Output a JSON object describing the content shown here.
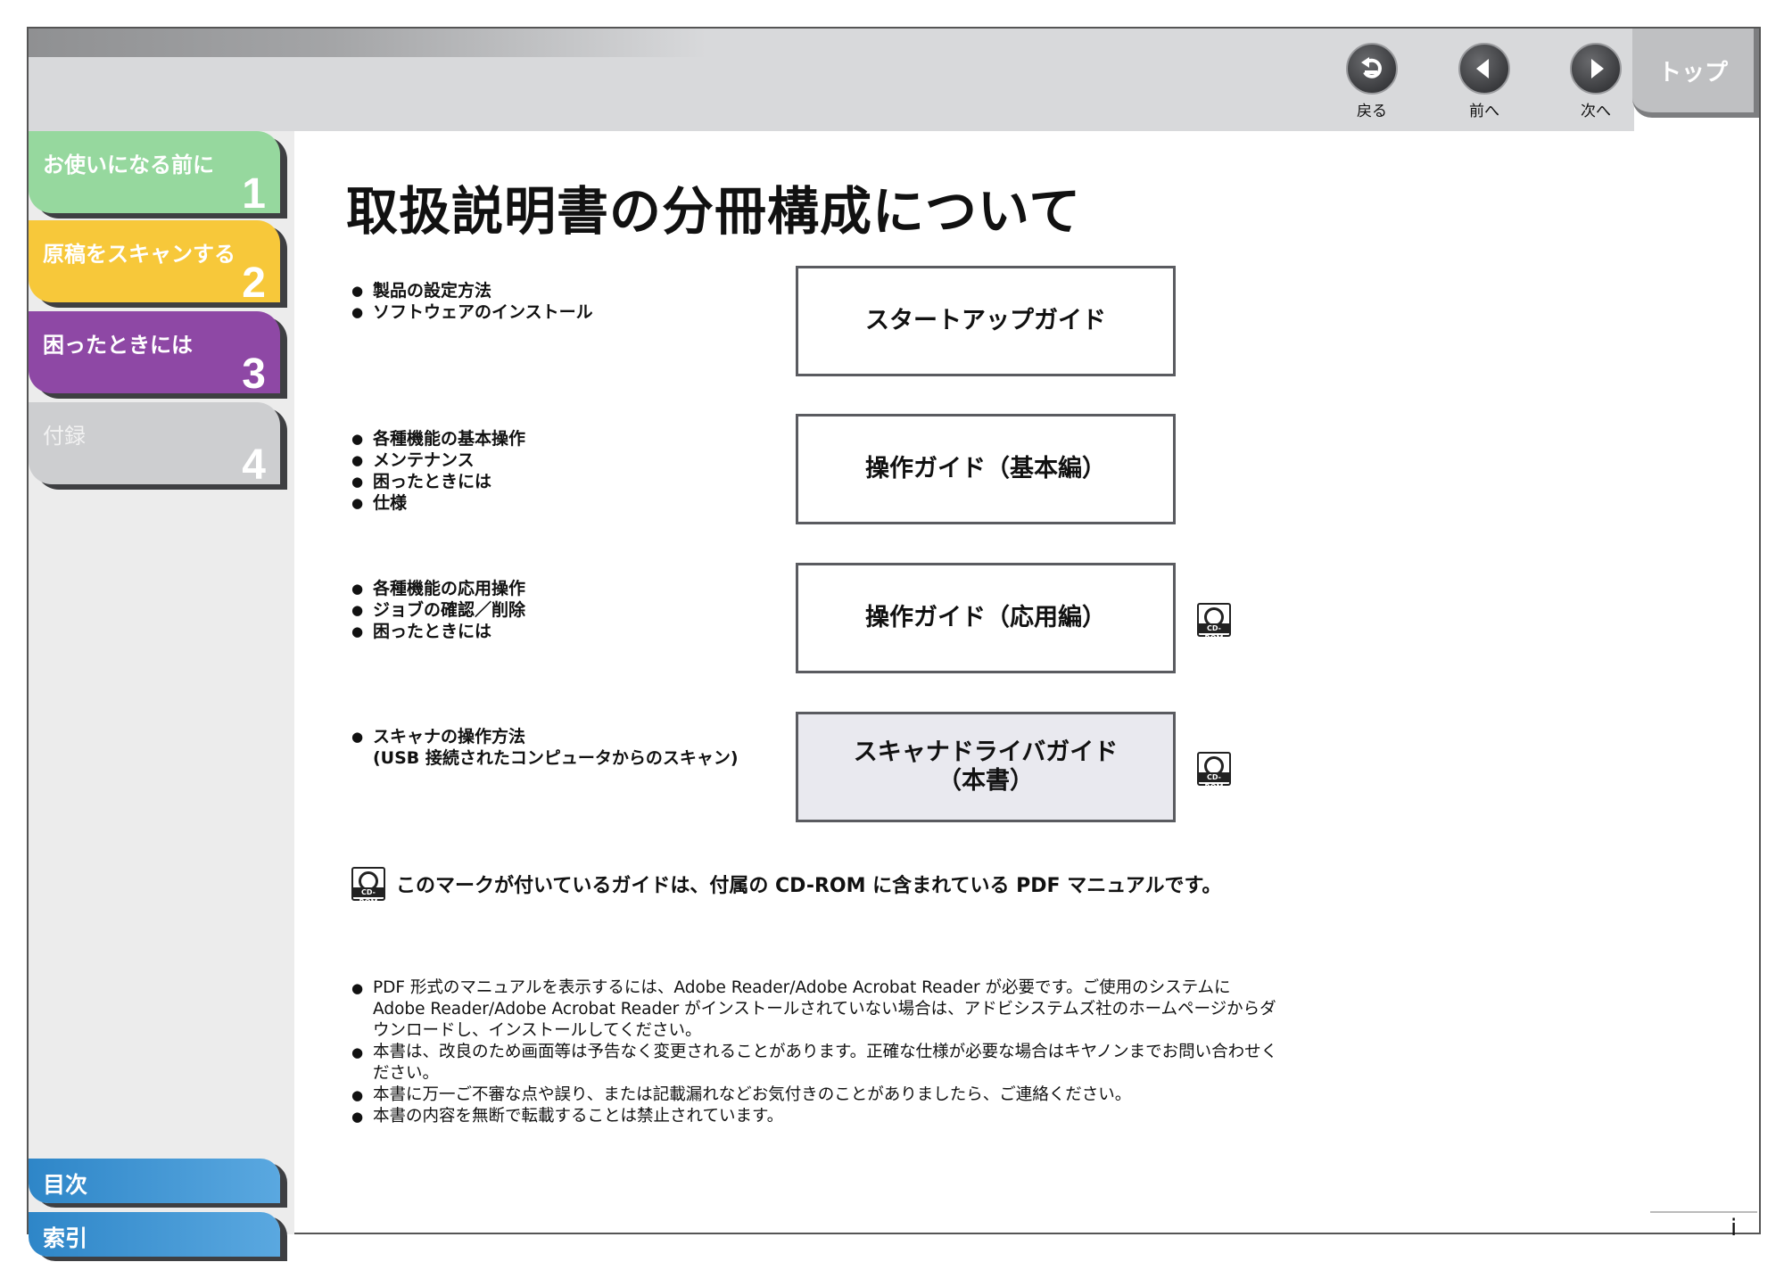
{
  "header": {
    "back_label": "戻る",
    "prev_label": "前へ",
    "next_label": "次へ",
    "top_label": "トップ"
  },
  "sidebar": {
    "chapters": [
      {
        "title": "お使いになる前に",
        "number": "1"
      },
      {
        "title": "原稿をスキャンする",
        "number": "2"
      },
      {
        "title": "困ったときには",
        "number": "3"
      },
      {
        "title": "付録",
        "number": "4"
      }
    ],
    "contents_label": "目次",
    "index_label": "索引"
  },
  "main": {
    "title": "取扱説明書の分冊構成について",
    "guides": [
      {
        "bullets": [
          "製品の設定方法",
          "ソフトウェアのインストール"
        ],
        "name": "スタートアップガイド",
        "name2": ""
      },
      {
        "bullets": [
          "各種機能の基本操作",
          "メンテナンス",
          "困ったときには",
          "仕様"
        ],
        "name": "操作ガイド（基本編）",
        "name2": ""
      },
      {
        "bullets": [
          "各種機能の応用操作",
          "ジョブの確認／削除",
          "困ったときには"
        ],
        "name": "操作ガイド（応用編）",
        "name2": ""
      },
      {
        "bullets": [
          "スキャナの操作方法",
          "(USB 接続されたコンピュータからのスキャン)"
        ],
        "name": "スキャナドライバガイド",
        "name2": "（本書）"
      }
    ],
    "cd_rom_label": "CD-ROM",
    "cd_note": "このマークが付いているガイドは、付属の CD-ROM に含まれている PDF マニュアルです。",
    "footnotes": [
      "PDF 形式のマニュアルを表示するには、Adobe Reader/Adobe Acrobat Reader が必要です。ご使用のシステムに Adobe Reader/Adobe Acrobat Reader がインストールされていない場合は、アドビシステムズ社のホームページからダウンロードし、インストールしてください。",
      "本書は、改良のため画面等は予告なく変更されることがあります。正確な仕様が必要な場合はキヤノンまでお問い合わせください。",
      "本書に万一ご不審な点や誤り、または記載漏れなどお気付きのことがありましたら、ご連絡ください。",
      "本書の内容を無断で転載することは禁止されています。"
    ],
    "page_number": "i"
  }
}
